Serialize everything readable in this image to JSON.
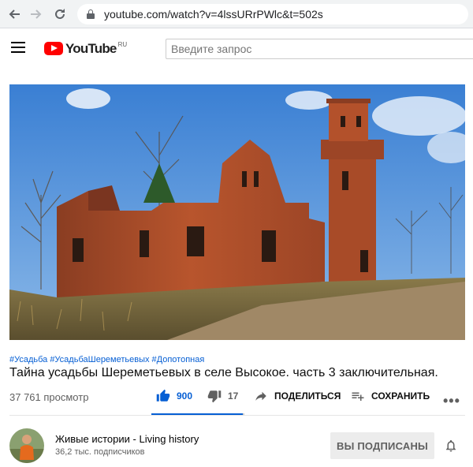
{
  "browser": {
    "url": "youtube.com/watch?v=4lssURrPWlc&t=502s"
  },
  "header": {
    "logo_text": "YouTube",
    "country_code": "RU",
    "search_placeholder": "Введите запрос"
  },
  "video": {
    "hashtags": [
      "#Усадьба",
      "#УсадьбаШереметьевых",
      "#Допотопная"
    ],
    "title": "Тайна усадьбы Шереметьевых в селе Высокое. часть 3 заключительная.",
    "views": "37 761 просмотр",
    "likes": "900",
    "dislikes": "17",
    "share_label": "ПОДЕЛИТЬСЯ",
    "save_label": "СОХРАНИТЬ",
    "more_label": "•••",
    "like_ratio": 0.98
  },
  "channel": {
    "name": "Живые истории - Living history",
    "subscribers": "36,2 тыс. подписчиков",
    "subscribe_button": "ВЫ ПОДПИСАНЫ"
  },
  "colors": {
    "accent": "#065fd4",
    "brand_red": "#ff0000"
  }
}
